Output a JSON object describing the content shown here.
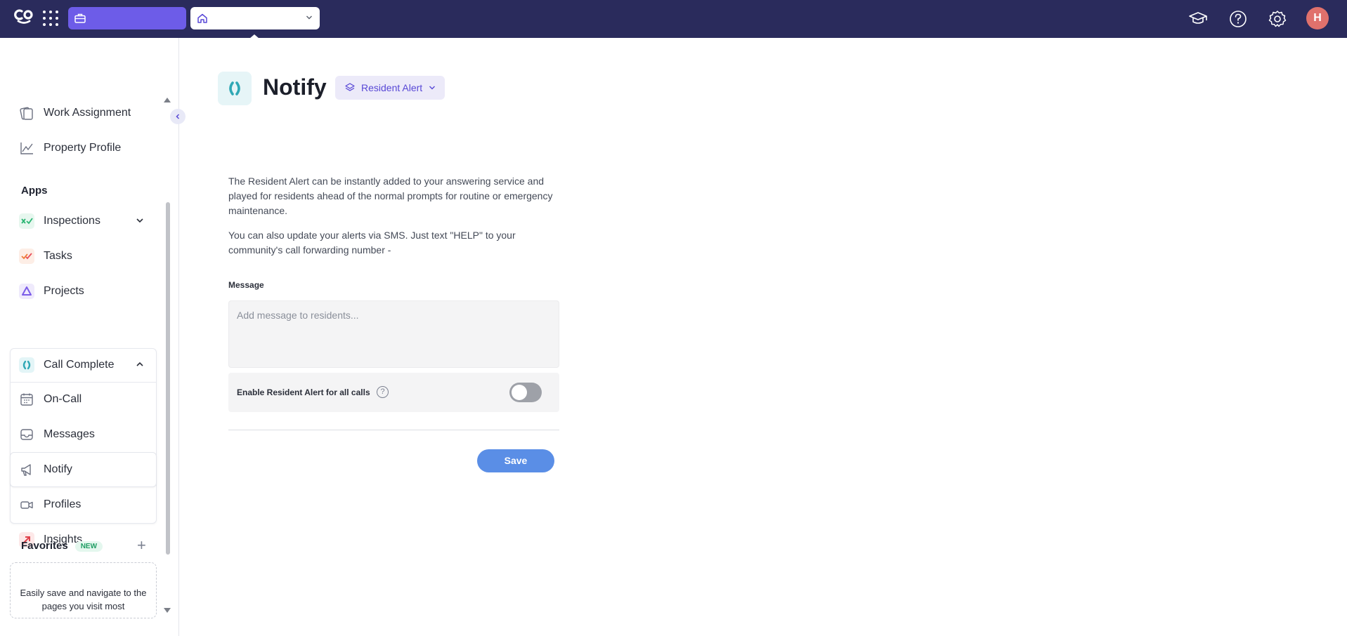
{
  "topbar": {
    "org_name": "",
    "page_name": "",
    "avatar_initial": "H",
    "colors": {
      "bar": "#2a2b5c",
      "org_select": "#6d5ce8",
      "avatar": "#e0716c"
    },
    "icons": [
      "logo-icon",
      "apps-grid-icon",
      "briefcase-icon",
      "home-icon",
      "chevron-down-icon",
      "graduation-cap-icon",
      "help-circle-icon",
      "settings-gear-icon"
    ]
  },
  "sidebar": {
    "items_top": [
      {
        "label": "Work Assignment",
        "icon": "work-assignment-icon"
      },
      {
        "label": "Property Profile",
        "icon": "property-chart-icon"
      }
    ],
    "apps_title": "Apps",
    "apps": [
      {
        "label": "Inspections",
        "icon": "inspections-icon",
        "expanded": false
      },
      {
        "label": "Tasks",
        "icon": "tasks-icon"
      },
      {
        "label": "Projects",
        "icon": "projects-icon"
      },
      {
        "label": "Call Complete",
        "icon": "call-complete-icon",
        "expanded": true
      }
    ],
    "call_complete_children": [
      {
        "label": "On-Call",
        "icon": "calendar-icon"
      },
      {
        "label": "Messages",
        "icon": "inbox-icon"
      },
      {
        "label": "Notify",
        "icon": "megaphone-icon",
        "active": true
      },
      {
        "label": "Profiles",
        "icon": "video-icon"
      }
    ],
    "insights": {
      "label": "Insights",
      "icon": "insights-arrow-icon"
    },
    "favorites": {
      "title": "Favorites",
      "badge": "NEW",
      "empty_text": "Easily save and navigate to the pages you visit most"
    }
  },
  "main": {
    "title": "Notify",
    "alert_selector": "Resident Alert",
    "description_1": "The Resident Alert can be instantly added to your answering service and played for residents ahead of the normal prompts for routine or emergency maintenance.",
    "description_2": "You can also update your alerts via SMS. Just text \"HELP\" to your community's call forwarding number -",
    "message_label": "Message",
    "message_placeholder": "Add message to residents...",
    "message_value": "",
    "toggle_label": "Enable Resident Alert for all calls",
    "toggle_on": false,
    "save_label": "Save",
    "colors": {
      "accent": "#5848d6",
      "save": "#5a8ee6",
      "app_icon": "#2fa8b5"
    }
  }
}
